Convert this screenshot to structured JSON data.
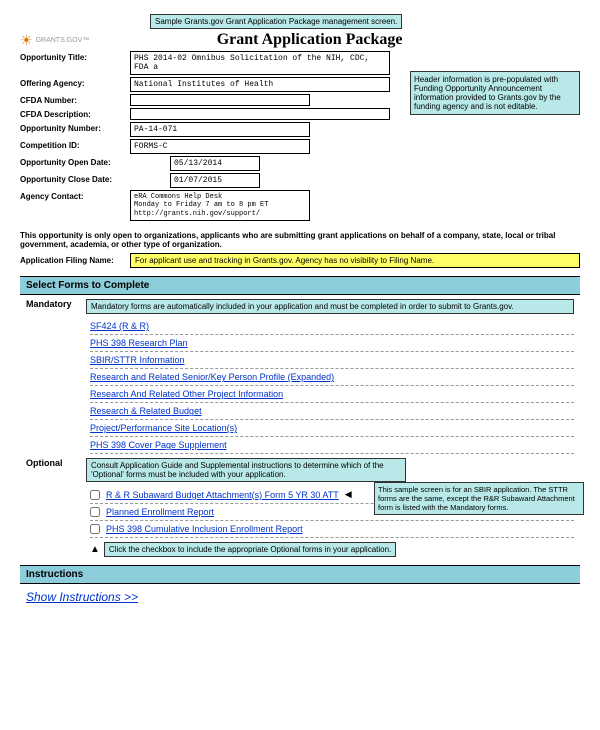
{
  "top_callout": "Sample Grants.gov Grant Application Package management screen.",
  "logo_text": "GRANTS.GOV™",
  "page_title": "Grant Application Package",
  "fields": {
    "opportunity_title": {
      "label": "Opportunity Title:",
      "value": "PHS 2014-02 Omnibus Solicitation of the NIH, CDC, FDA a"
    },
    "offering_agency": {
      "label": "Offering Agency:",
      "value": "National Institutes of Health"
    },
    "cfda_number": {
      "label": "CFDA Number:",
      "value": ""
    },
    "cfda_description": {
      "label": "CFDA Description:",
      "value": ""
    },
    "opportunity_number": {
      "label": "Opportunity Number:",
      "value": "PA-14-071"
    },
    "competition_id": {
      "label": "Competition ID:",
      "value": "FORMS-C"
    },
    "open_date": {
      "label": "Opportunity Open Date:",
      "value": "05/13/2014"
    },
    "close_date": {
      "label": "Opportunity Close Date:",
      "value": "01/07/2015"
    },
    "agency_contact": {
      "label": "Agency Contact:",
      "line1": "eRA Commons Help Desk",
      "line2": "Monday to Friday 7 am to 8 pm ET",
      "line3": "http://grants.nih.gov/support/"
    }
  },
  "header_note": "Header information is pre-populated with Funding Opportunity Announcement information provided to Grants.gov by the funding agency and is not editable.",
  "org_note": "This opportunity is only open to organizations, applicants who are submitting grant applications on behalf of a company, state, local or tribal government, academia, or other type of organization.",
  "filing": {
    "label": "Application Filing Name:",
    "value": "For applicant use and tracking in Grants.gov. Agency has no visibility to Filing Name."
  },
  "sections": {
    "select_forms": "Select Forms to Complete",
    "mandatory": "Mandatory",
    "mandatory_note": "Mandatory forms are automatically included in your application and must be completed in order to submit to Grants.gov.",
    "optional": "Optional",
    "optional_note": "Consult Application Guide and Supplemental instructions to determine which of the 'Optional' forms must be included with your application.",
    "instructions": "Instructions"
  },
  "mandatory_forms": [
    "SF424 (R & R)",
    "PHS 398 Research Plan",
    "SBIR/STTR Information",
    "Research and Related Senior/Key Person Profile (Expanded)",
    "Research And Related Other Project Information",
    "Research & Related Budget",
    "Project/Performance Site Location(s)",
    "PHS 398 Cover Page Supplement"
  ],
  "optional_forms": [
    "R & R Subaward Budget Attachment(s) Form 5 YR 30 ATT",
    "Planned Enrollment Report",
    "PHS 398 Cumulative Inclusion Enrollment Report"
  ],
  "optional_side_note": "This sample screen is for an SBIR application. The STTR forms are the same, except the R&R Subaward Attachment form is listed with the Mandatory forms.",
  "checkbox_note": "Click the checkbox to include the appropriate Optional forms in your application.",
  "show_instructions": "Show Instructions >>"
}
